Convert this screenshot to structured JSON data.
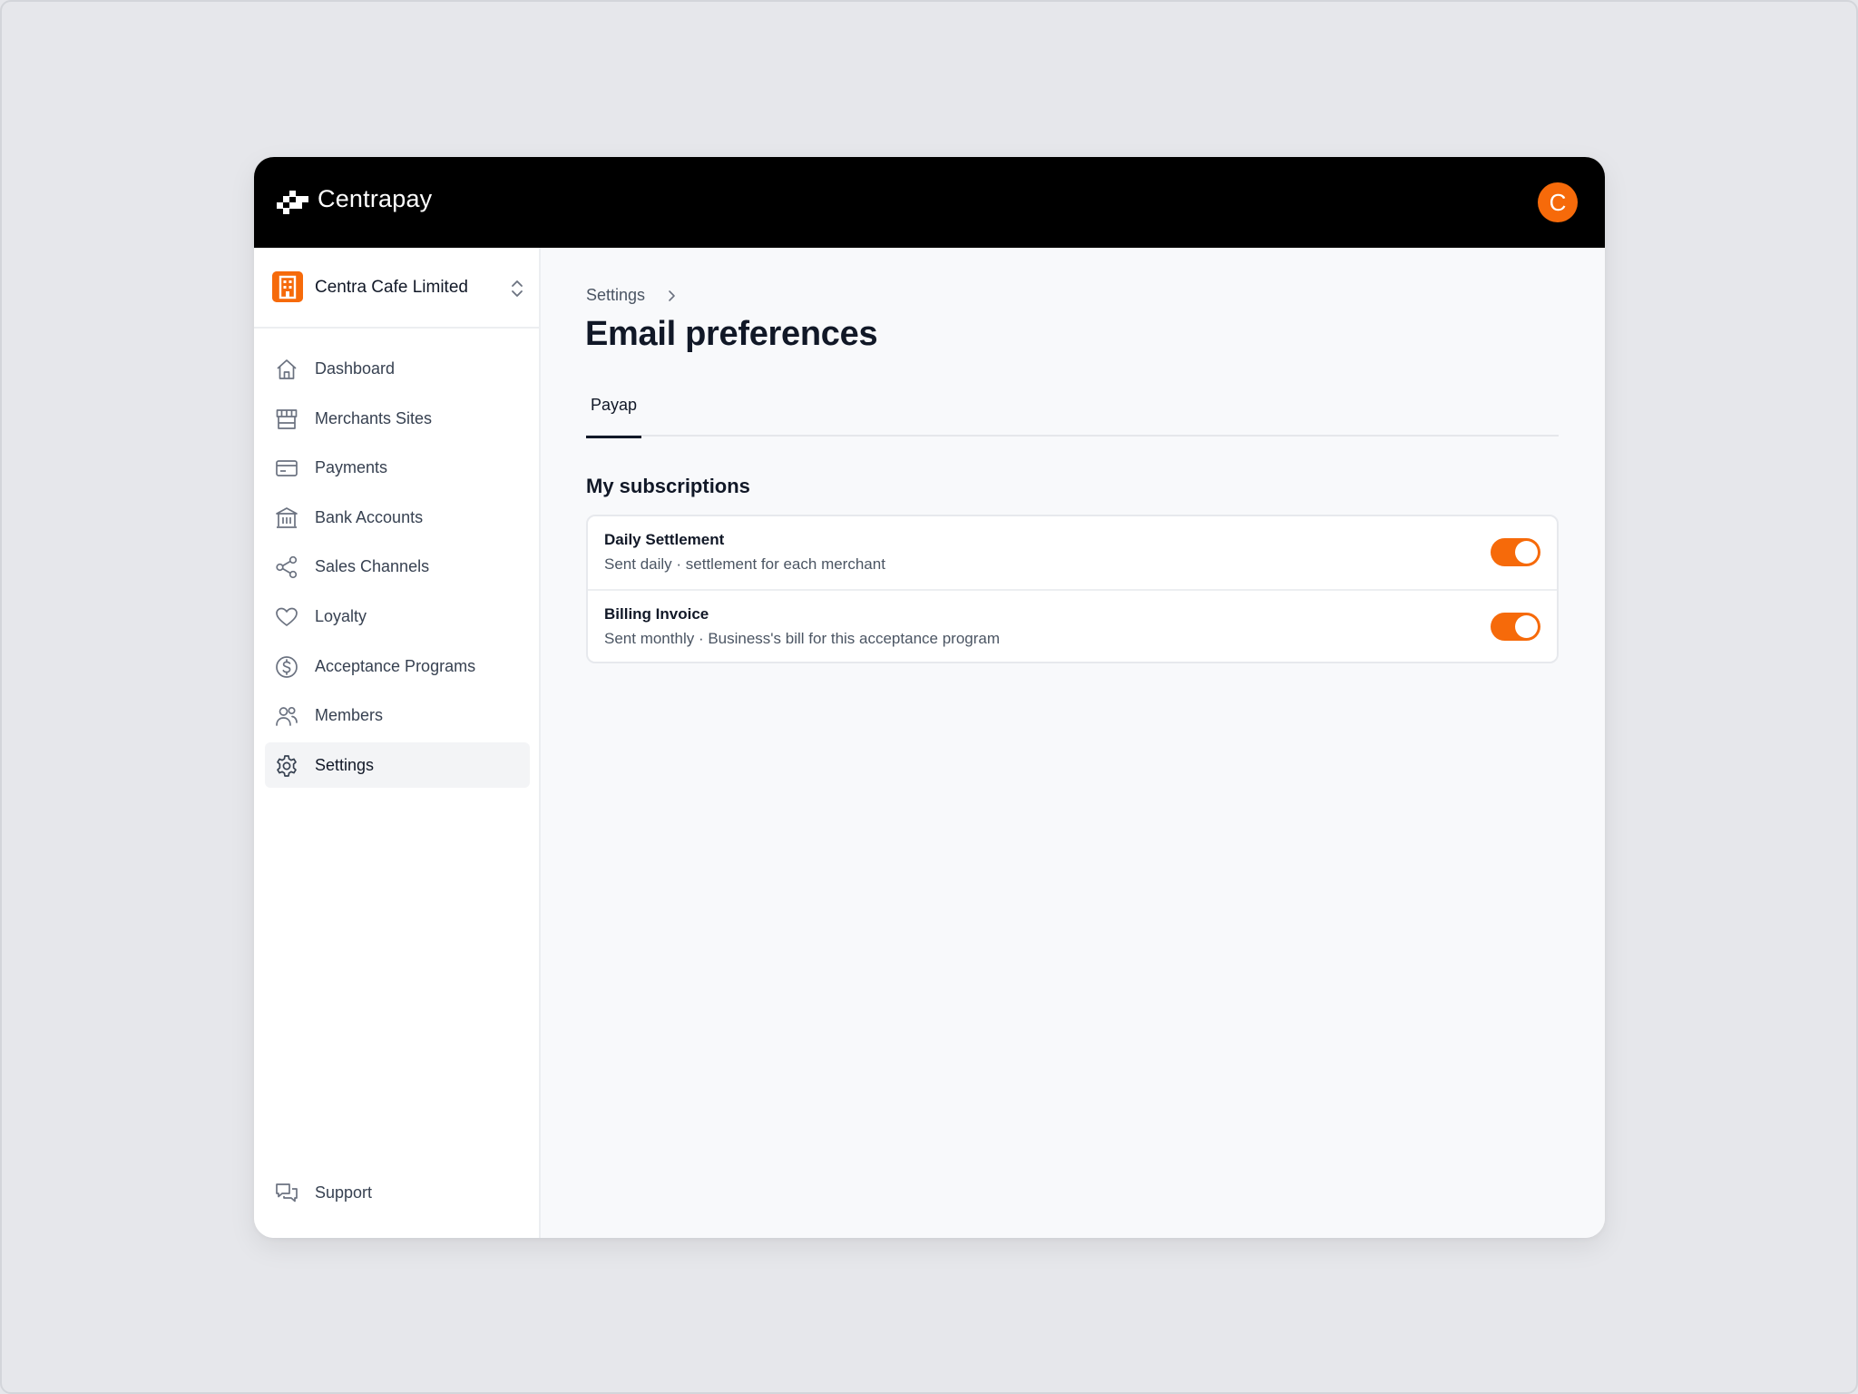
{
  "header": {
    "brand": "Centrapay",
    "avatar_initial": "C",
    "avatar_color": "#f66a0a"
  },
  "org": {
    "name": "Centra Cafe Limited",
    "icon": "building-icon"
  },
  "sidebar": {
    "items": [
      {
        "label": "Dashboard",
        "icon": "home-icon"
      },
      {
        "label": "Merchants Sites",
        "icon": "store-icon"
      },
      {
        "label": "Payments",
        "icon": "credit-card-icon"
      },
      {
        "label": "Bank Accounts",
        "icon": "bank-icon"
      },
      {
        "label": "Sales Channels",
        "icon": "share-icon"
      },
      {
        "label": "Loyalty",
        "icon": "heart-icon"
      },
      {
        "label": "Acceptance Programs",
        "icon": "dollar-circle-icon"
      },
      {
        "label": "Members",
        "icon": "users-icon"
      },
      {
        "label": "Settings",
        "icon": "gear-icon",
        "active": true
      }
    ],
    "support": {
      "label": "Support",
      "icon": "chat-icon"
    }
  },
  "main": {
    "breadcrumb": "Settings",
    "title": "Email preferences",
    "tabs": [
      {
        "label": "Payap",
        "active": true
      }
    ],
    "section_title": "My subscriptions",
    "subscriptions": [
      {
        "title": "Daily Settlement",
        "description": "Sent daily · settlement for each merchant",
        "enabled": true
      },
      {
        "title": "Billing Invoice",
        "description": "Sent monthly · Business's bill for this acceptance program",
        "enabled": true
      }
    ]
  },
  "colors": {
    "accent": "#f66a0a",
    "topbar": "#000000"
  }
}
